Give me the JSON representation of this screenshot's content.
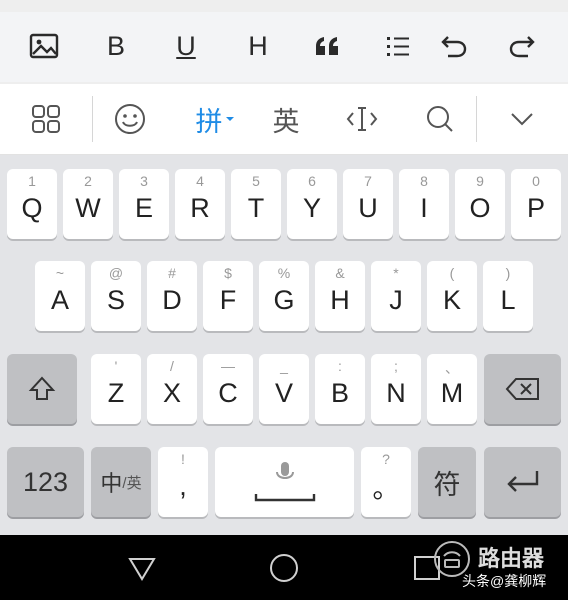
{
  "toolbar": {
    "items": [
      {
        "name": "image-icon"
      },
      {
        "name": "bold-button",
        "label": "B"
      },
      {
        "name": "underline-button",
        "label": "U"
      },
      {
        "name": "heading-button",
        "label": "H"
      },
      {
        "name": "quote-button",
        "label": "66"
      },
      {
        "name": "list-icon"
      },
      {
        "name": "undo-icon"
      },
      {
        "name": "redo-icon"
      }
    ]
  },
  "candidates": {
    "pinyin_label": "拼",
    "english_label": "英",
    "accent_color": "#1f8ce6"
  },
  "keys": {
    "row1": [
      {
        "main": "Q",
        "hint": "1"
      },
      {
        "main": "W",
        "hint": "2"
      },
      {
        "main": "E",
        "hint": "3"
      },
      {
        "main": "R",
        "hint": "4"
      },
      {
        "main": "T",
        "hint": "5"
      },
      {
        "main": "Y",
        "hint": "6"
      },
      {
        "main": "U",
        "hint": "7"
      },
      {
        "main": "I",
        "hint": "8"
      },
      {
        "main": "O",
        "hint": "9"
      },
      {
        "main": "P",
        "hint": "0"
      }
    ],
    "row2": [
      {
        "main": "A",
        "hint": "~"
      },
      {
        "main": "S",
        "hint": "@"
      },
      {
        "main": "D",
        "hint": "#"
      },
      {
        "main": "F",
        "hint": "$"
      },
      {
        "main": "G",
        "hint": "%"
      },
      {
        "main": "H",
        "hint": "&"
      },
      {
        "main": "J",
        "hint": "*"
      },
      {
        "main": "K",
        "hint": "("
      },
      {
        "main": "L",
        "hint": ")"
      }
    ],
    "row3": [
      {
        "main": "Z",
        "hint": "'"
      },
      {
        "main": "X",
        "hint": "/"
      },
      {
        "main": "C",
        "hint": "—"
      },
      {
        "main": "V",
        "hint": "_"
      },
      {
        "main": "B",
        "hint": ":"
      },
      {
        "main": "N",
        "hint": ";"
      },
      {
        "main": "M",
        "hint": "、"
      }
    ],
    "num_label": "123",
    "lang_main": "中",
    "lang_sub": "/英",
    "comma_main": ",",
    "comma_hint": "!",
    "period_main": "。",
    "period_hint": "?",
    "symbol_label": "符"
  },
  "watermark": {
    "line1": "路由器",
    "line2": "头条@龚柳辉"
  }
}
